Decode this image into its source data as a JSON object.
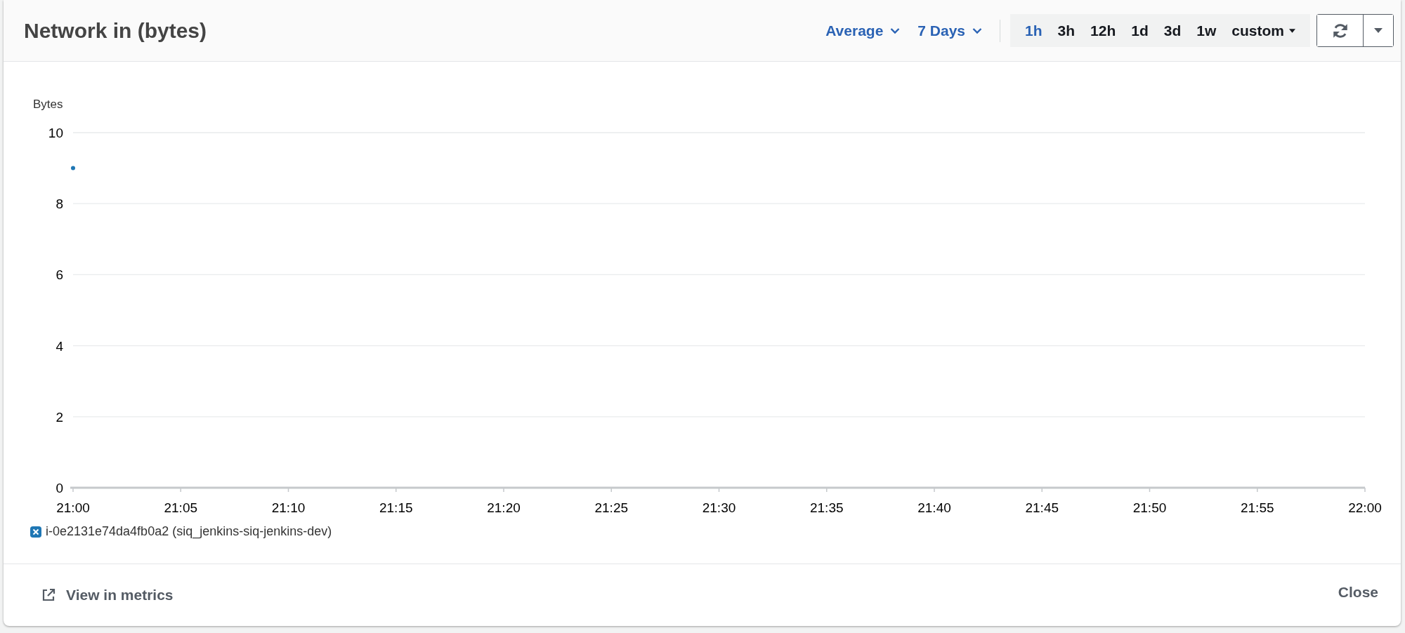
{
  "dialog": {
    "title": "Network in (bytes)"
  },
  "controls": {
    "statistic": "Average",
    "period": "7 Days"
  },
  "time_ranges": [
    {
      "label": "1h",
      "selected": true
    },
    {
      "label": "3h",
      "selected": false
    },
    {
      "label": "12h",
      "selected": false
    },
    {
      "label": "1d",
      "selected": false
    },
    {
      "label": "3d",
      "selected": false
    },
    {
      "label": "1w",
      "selected": false
    }
  ],
  "custom_range": "custom",
  "chart": {
    "chart_data": {
      "type": "line",
      "ylabel": "Bytes",
      "categories": [
        "21:00",
        "21:05",
        "21:10",
        "21:15",
        "21:20",
        "21:25",
        "21:30",
        "21:35",
        "21:40",
        "21:45",
        "21:50",
        "21:55",
        "22:00"
      ],
      "series": [
        {
          "name": "i-0e2131e74da4fb0a2 (siq_jenkins-siq-jenkins-dev)",
          "color": "#1f77b4",
          "marker": "circle",
          "values": [
            9,
            null,
            null,
            null,
            null,
            null,
            null,
            null,
            null,
            null,
            null,
            null,
            null
          ]
        }
      ],
      "ylim": [
        0,
        10
      ],
      "yticks": [
        0,
        2,
        4,
        6,
        8,
        10
      ],
      "grid": true
    }
  },
  "legend": [
    {
      "checked": true
    }
  ],
  "footer": {
    "link": "View in metrics",
    "close": "Close"
  }
}
